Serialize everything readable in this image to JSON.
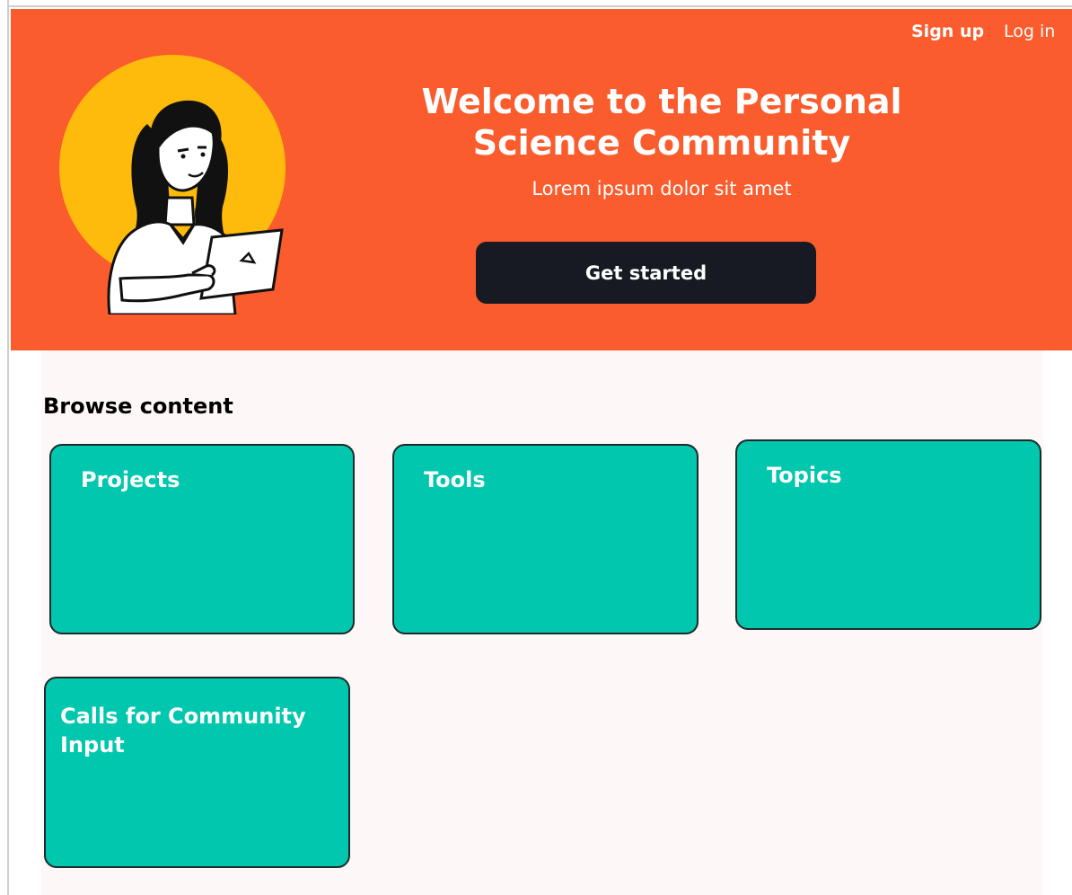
{
  "nav": {
    "signup_label": "Sign up",
    "login_label": "Log in"
  },
  "hero": {
    "title": "Welcome to the Personal\nScience Community",
    "subtitle": "Lorem ipsum dolor sit amet",
    "cta_label": "Get started",
    "illustration": "person-with-laptop"
  },
  "browse": {
    "title": "Browse content",
    "cards": [
      {
        "label": "Projects"
      },
      {
        "label": "Tools"
      },
      {
        "label": "Topics"
      },
      {
        "label": "Calls for Community Input"
      }
    ]
  },
  "colors": {
    "hero_background": "#fa5c2d",
    "accent_circle": "#ffbb0b",
    "cta_background": "#171a22",
    "card_background": "#00c7ad",
    "content_background": "#fdf8f7"
  }
}
